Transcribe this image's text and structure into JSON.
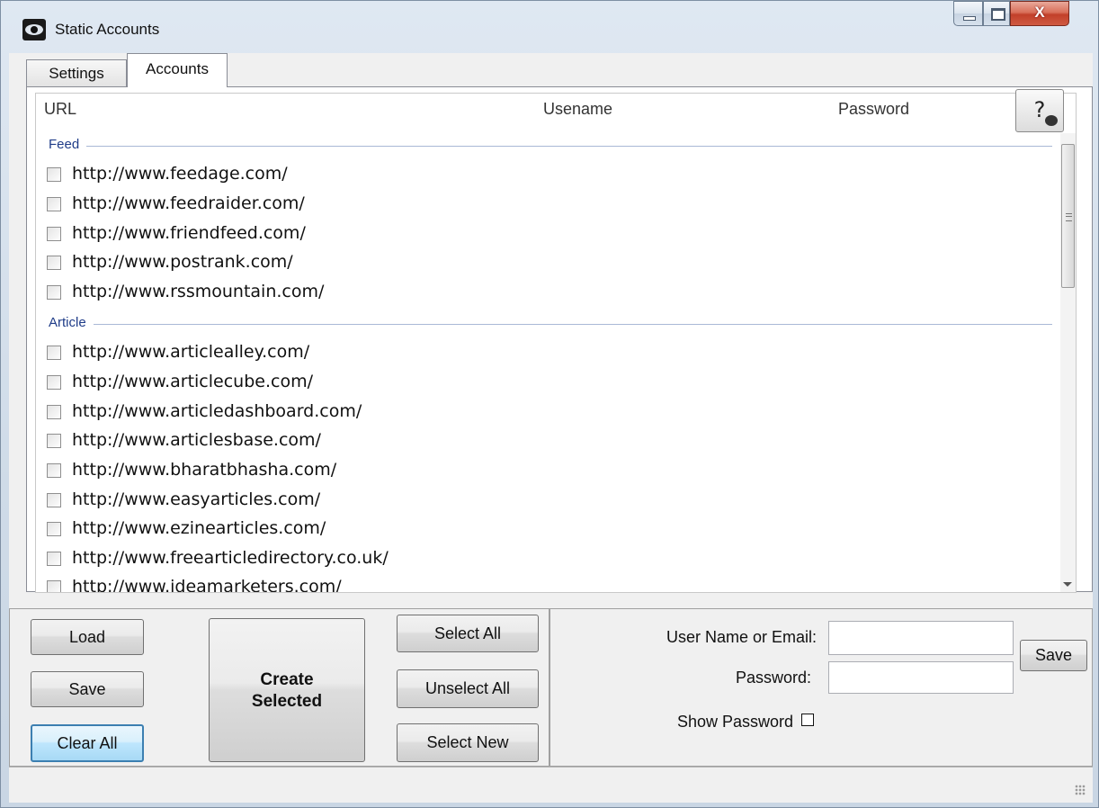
{
  "window": {
    "title": "Static Accounts"
  },
  "tabs": [
    {
      "label": "Settings"
    },
    {
      "label": "Accounts"
    }
  ],
  "columns": {
    "url": "URL",
    "username": "Usename",
    "password": "Password"
  },
  "groups": {
    "feed": {
      "label": "Feed",
      "items": [
        "http://www.feedage.com/",
        "http://www.feedraider.com/",
        "http://www.friendfeed.com/",
        "http://www.postrank.com/",
        "http://www.rssmountain.com/"
      ]
    },
    "article": {
      "label": "Article",
      "items": [
        "http://www.articlealley.com/",
        "http://www.articlecube.com/",
        "http://www.articledashboard.com/",
        "http://www.articlesbase.com/",
        "http://www.bharatbhasha.com/",
        "http://www.easyarticles.com/",
        "http://www.ezinearticles.com/",
        "http://www.freearticledirectory.co.uk/",
        "http://www.ideamarketers.com/"
      ]
    }
  },
  "buttons": {
    "load": "Load",
    "save": "Save",
    "clear_all": "Clear All",
    "create_selected_line1": "Create",
    "create_selected_line2": "Selected",
    "select_all": "Select All",
    "unselect_all": "Unselect All",
    "select_new": "Select New",
    "account_save": "Save"
  },
  "account_form": {
    "username_label": "User Name or Email:",
    "username_value": "",
    "password_label": "Password:",
    "password_value": "",
    "show_password_label": "Show Password",
    "show_password_checked": false
  },
  "icons": {
    "app": "eye-icon",
    "help": "help-icon",
    "minimize": "minimize-icon",
    "maximize": "maximize-icon",
    "close": "close-icon"
  }
}
